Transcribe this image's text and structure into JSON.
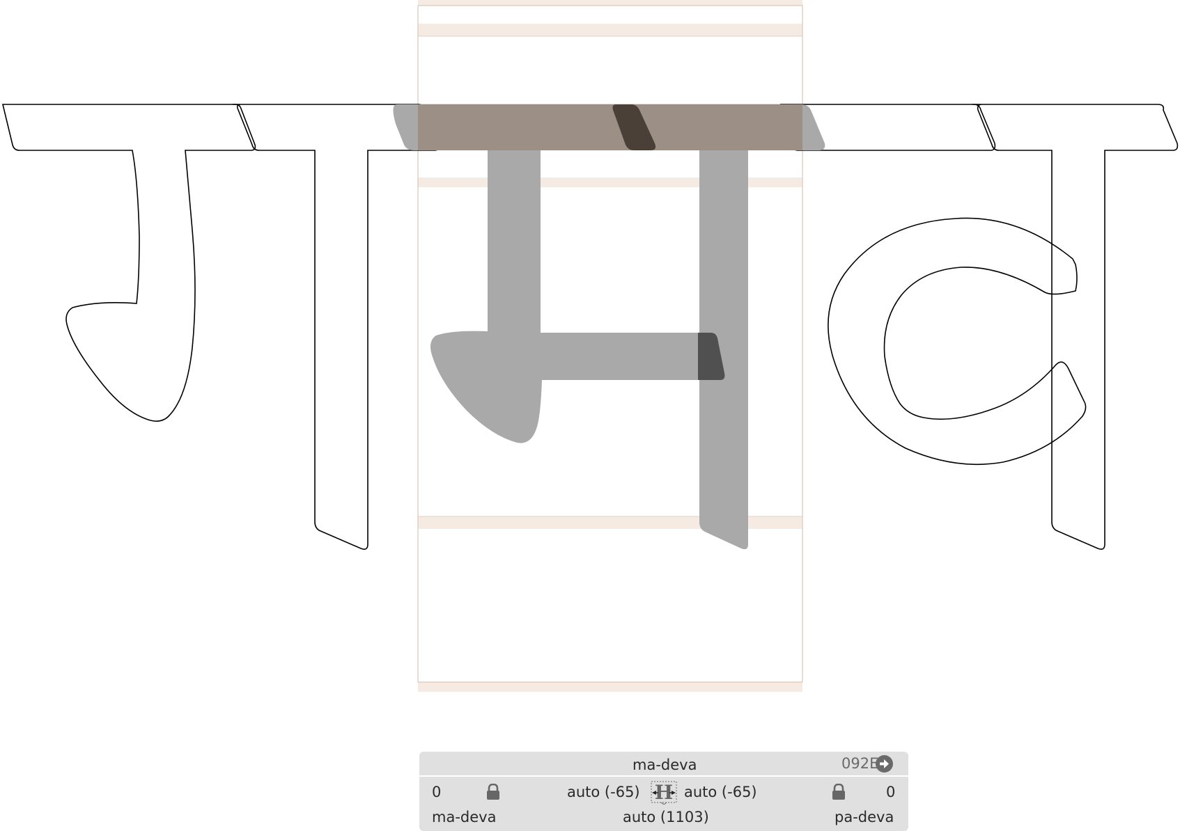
{
  "glyph_info": {
    "name": "ma-deva",
    "unicode": "092E",
    "next_icon": "arrow-right-circle-icon"
  },
  "metrics": {
    "lsb_value": "0",
    "lsb_lock_icon": "lock-icon",
    "left_kern": "auto (-65)",
    "metrics_toggle_icon": "metrics-H-icon",
    "right_kern": "auto (-65)",
    "rsb_lock_icon": "lock-icon",
    "rsb_value": "0",
    "left_glyph": "ma-deva",
    "width": "auto (1103)",
    "right_glyph": "pa-deva"
  },
  "colors": {
    "guide_band": "#f5ebe3",
    "guide_line": "#e2d2c6",
    "active_fill": "#9e9e9e",
    "overlap_fill": "#4a4a4a",
    "panel_bg": "#e0e0e0"
  }
}
